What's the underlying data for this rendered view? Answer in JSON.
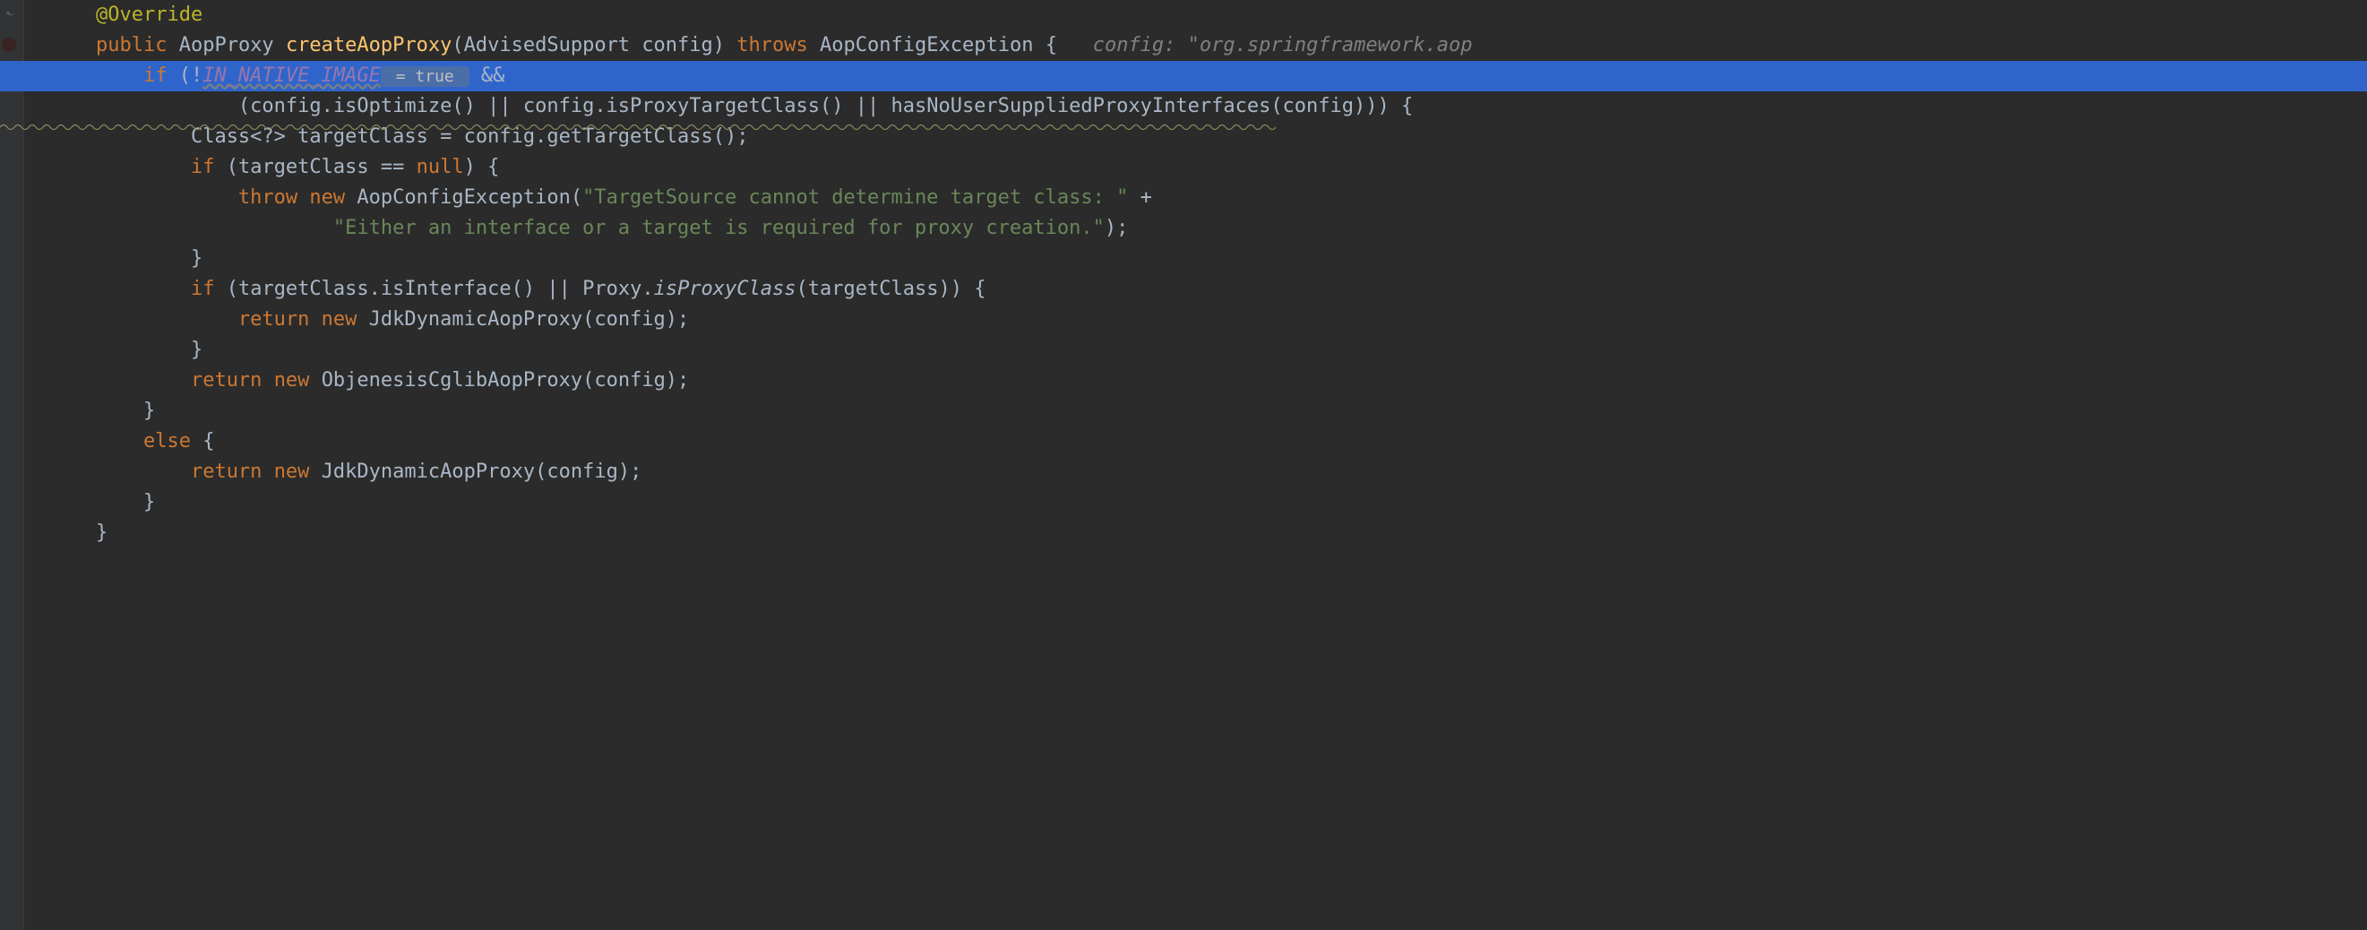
{
  "editor": {
    "highlighted_line_index": 2
  },
  "code": {
    "lines": [
      {
        "indent": 1,
        "tokens": [
          {
            "cls": "tk-annotation",
            "t": "@Override"
          }
        ]
      },
      {
        "indent": 1,
        "tokens": [
          {
            "cls": "tk-keyword",
            "t": "public"
          },
          {
            "cls": "sp",
            "t": " "
          },
          {
            "cls": "tk-type",
            "t": "AopProxy"
          },
          {
            "cls": "sp",
            "t": " "
          },
          {
            "cls": "tk-method-decl",
            "t": "createAopProxy"
          },
          {
            "cls": "tk-punct",
            "t": "("
          },
          {
            "cls": "tk-type",
            "t": "AdvisedSupport"
          },
          {
            "cls": "sp",
            "t": " "
          },
          {
            "cls": "tk-param",
            "t": "config"
          },
          {
            "cls": "tk-punct",
            "t": ")"
          },
          {
            "cls": "sp",
            "t": " "
          },
          {
            "cls": "tk-keyword",
            "t": "throws"
          },
          {
            "cls": "sp",
            "t": " "
          },
          {
            "cls": "tk-type",
            "t": "AopConfigException"
          },
          {
            "cls": "sp",
            "t": " "
          },
          {
            "cls": "tk-punct",
            "t": "{"
          },
          {
            "cls": "sp",
            "t": "   "
          },
          {
            "cls": "tk-comment",
            "t": "config: \"org.springframework.aop"
          }
        ]
      },
      {
        "indent": 2,
        "tokens": [
          {
            "cls": "tk-keyword",
            "t": "if"
          },
          {
            "cls": "sp",
            "t": " "
          },
          {
            "cls": "tk-punct",
            "t": "("
          },
          {
            "cls": "tk-op",
            "t": "!"
          },
          {
            "cls": "tk-const",
            "t": "IN_NATIVE_IMAGE"
          },
          {
            "cls": "inline-hint boxed",
            "t": " = true "
          },
          {
            "cls": "sp",
            "t": " "
          },
          {
            "cls": "tk-op",
            "t": "&&"
          }
        ]
      },
      {
        "indent": 4,
        "tokens": [
          {
            "cls": "tk-punct",
            "t": "("
          },
          {
            "cls": "tk-method-call",
            "t": "config.isOptimize()"
          },
          {
            "cls": "sp",
            "t": " "
          },
          {
            "cls": "tk-op",
            "t": "||"
          },
          {
            "cls": "sp",
            "t": " "
          },
          {
            "cls": "tk-method-call",
            "t": "config.isProxyTargetClass()"
          },
          {
            "cls": "sp",
            "t": " "
          },
          {
            "cls": "tk-op",
            "t": "||"
          },
          {
            "cls": "sp",
            "t": " "
          },
          {
            "cls": "tk-method-call",
            "t": "hasNoUserSuppliedProxyInterfaces(config)"
          },
          {
            "cls": "tk-punct",
            "t": "))"
          },
          {
            "cls": "sp",
            "t": " "
          },
          {
            "cls": "tk-punct",
            "t": "{"
          }
        ]
      },
      {
        "indent": 3,
        "tokens": [
          {
            "cls": "tk-type",
            "t": "Class<?>"
          },
          {
            "cls": "sp",
            "t": " "
          },
          {
            "cls": "tk-param",
            "t": "targetClass"
          },
          {
            "cls": "sp",
            "t": " "
          },
          {
            "cls": "tk-op",
            "t": "="
          },
          {
            "cls": "sp",
            "t": " "
          },
          {
            "cls": "tk-method-call",
            "t": "config.getTargetClass();"
          }
        ]
      },
      {
        "indent": 3,
        "tokens": [
          {
            "cls": "tk-keyword",
            "t": "if"
          },
          {
            "cls": "sp",
            "t": " "
          },
          {
            "cls": "tk-punct",
            "t": "("
          },
          {
            "cls": "tk-param",
            "t": "targetClass"
          },
          {
            "cls": "sp",
            "t": " "
          },
          {
            "cls": "tk-op",
            "t": "=="
          },
          {
            "cls": "sp",
            "t": " "
          },
          {
            "cls": "tk-null",
            "t": "null"
          },
          {
            "cls": "tk-punct",
            "t": ")"
          },
          {
            "cls": "sp",
            "t": " "
          },
          {
            "cls": "tk-punct",
            "t": "{"
          }
        ]
      },
      {
        "indent": 4,
        "tokens": [
          {
            "cls": "tk-keyword",
            "t": "throw"
          },
          {
            "cls": "sp",
            "t": " "
          },
          {
            "cls": "tk-keyword",
            "t": "new"
          },
          {
            "cls": "sp",
            "t": " "
          },
          {
            "cls": "tk-type",
            "t": "AopConfigException"
          },
          {
            "cls": "tk-punct",
            "t": "("
          },
          {
            "cls": "tk-string",
            "t": "\"TargetSource cannot determine target class: \""
          },
          {
            "cls": "sp",
            "t": " "
          },
          {
            "cls": "tk-op",
            "t": "+"
          }
        ]
      },
      {
        "indent": 6,
        "tokens": [
          {
            "cls": "tk-string",
            "t": "\"Either an interface or a target is required for proxy creation.\""
          },
          {
            "cls": "tk-punct",
            "t": ");"
          }
        ]
      },
      {
        "indent": 3,
        "tokens": [
          {
            "cls": "tk-punct",
            "t": "}"
          }
        ]
      },
      {
        "indent": 3,
        "tokens": [
          {
            "cls": "tk-keyword",
            "t": "if"
          },
          {
            "cls": "sp",
            "t": " "
          },
          {
            "cls": "tk-punct",
            "t": "("
          },
          {
            "cls": "tk-method-call",
            "t": "targetClass.isInterface()"
          },
          {
            "cls": "sp",
            "t": " "
          },
          {
            "cls": "tk-op",
            "t": "||"
          },
          {
            "cls": "sp",
            "t": " "
          },
          {
            "cls": "tk-type",
            "t": "Proxy"
          },
          {
            "cls": "tk-punct",
            "t": "."
          },
          {
            "cls": "tk-static-call",
            "t": "isProxyClass"
          },
          {
            "cls": "tk-punct",
            "t": "("
          },
          {
            "cls": "tk-param",
            "t": "targetClass"
          },
          {
            "cls": "tk-punct",
            "t": "))"
          },
          {
            "cls": "sp",
            "t": " "
          },
          {
            "cls": "tk-punct",
            "t": "{"
          }
        ]
      },
      {
        "indent": 4,
        "tokens": [
          {
            "cls": "tk-keyword",
            "t": "return"
          },
          {
            "cls": "sp",
            "t": " "
          },
          {
            "cls": "tk-keyword",
            "t": "new"
          },
          {
            "cls": "sp",
            "t": " "
          },
          {
            "cls": "tk-type",
            "t": "JdkDynamicAopProxy"
          },
          {
            "cls": "tk-punct",
            "t": "(config);"
          }
        ]
      },
      {
        "indent": 3,
        "tokens": [
          {
            "cls": "tk-punct",
            "t": "}"
          }
        ]
      },
      {
        "indent": 3,
        "tokens": [
          {
            "cls": "tk-keyword",
            "t": "return"
          },
          {
            "cls": "sp",
            "t": " "
          },
          {
            "cls": "tk-keyword",
            "t": "new"
          },
          {
            "cls": "sp",
            "t": " "
          },
          {
            "cls": "tk-type",
            "t": "ObjenesisCglibAopProxy"
          },
          {
            "cls": "tk-punct",
            "t": "(config);"
          }
        ]
      },
      {
        "indent": 2,
        "tokens": [
          {
            "cls": "tk-punct",
            "t": "}"
          }
        ]
      },
      {
        "indent": 2,
        "tokens": [
          {
            "cls": "tk-keyword",
            "t": "else"
          },
          {
            "cls": "sp",
            "t": " "
          },
          {
            "cls": "tk-punct",
            "t": "{"
          }
        ]
      },
      {
        "indent": 3,
        "tokens": [
          {
            "cls": "tk-keyword",
            "t": "return"
          },
          {
            "cls": "sp",
            "t": " "
          },
          {
            "cls": "tk-keyword",
            "t": "new"
          },
          {
            "cls": "sp",
            "t": " "
          },
          {
            "cls": "tk-type",
            "t": "JdkDynamicAopProxy"
          },
          {
            "cls": "tk-punct",
            "t": "(config);"
          }
        ]
      },
      {
        "indent": 2,
        "tokens": [
          {
            "cls": "tk-punct",
            "t": "}"
          }
        ]
      },
      {
        "indent": 1,
        "tokens": [
          {
            "cls": "tk-punct",
            "t": "}"
          }
        ]
      }
    ]
  }
}
